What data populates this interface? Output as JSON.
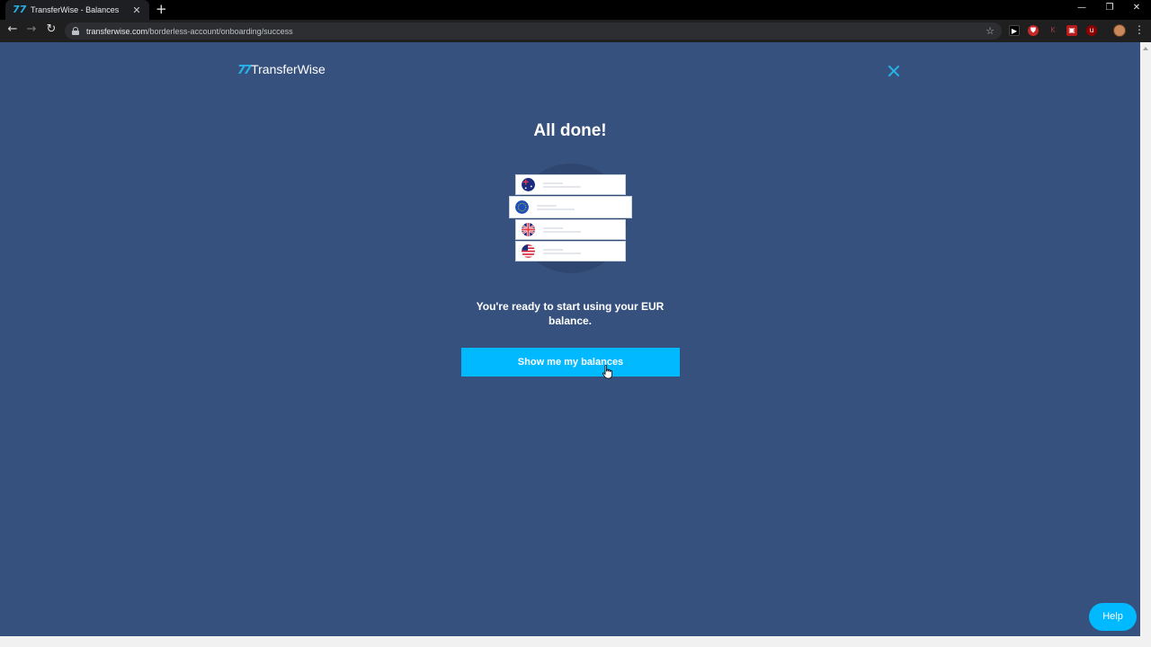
{
  "browser": {
    "tab_title": "TransferWise - Balances",
    "tab_favicon": "transferwise-logo-icon",
    "new_tab": "+",
    "url_host": "transferwise.com",
    "url_path": "/borderless-account/onboarding/success",
    "back": "←",
    "forward": "→",
    "reload": "↻",
    "star": "☆",
    "minimize": "—",
    "restore": "❐",
    "close": "✕",
    "menu": "⋮"
  },
  "brand": {
    "mark": "77",
    "name": "TransferWise",
    "accent_color": "#00b9ff",
    "background_color": "#37517e"
  },
  "main": {
    "heading": "All done!",
    "illustration_flags": [
      "australia-flag-icon",
      "eu-flag-icon",
      "uk-flag-icon",
      "us-flag-icon"
    ],
    "message": "You're ready to start using your EUR balance.",
    "cta_label": "Show me my balances"
  },
  "help": {
    "label": "Help"
  }
}
